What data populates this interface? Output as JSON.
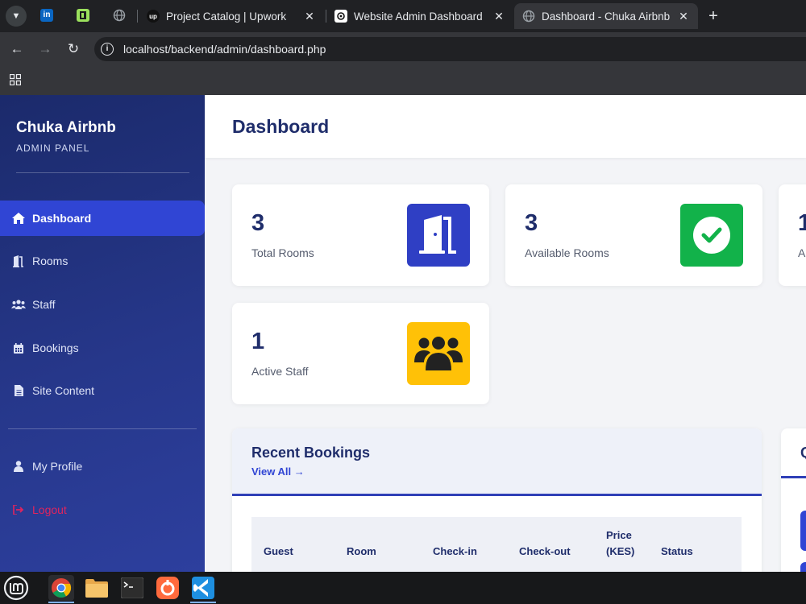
{
  "browser": {
    "tabs": [
      {
        "title": "Project Catalog | Upwork",
        "favicon": "upwork-icon"
      },
      {
        "title": "Website Admin Dashboard S",
        "favicon": "openai-icon"
      },
      {
        "title": "Dashboard - Chuka Airbnb",
        "favicon": "globe-icon",
        "active": true
      }
    ],
    "url": "localhost/backend/admin/dashboard.php",
    "pinned": {
      "linkedin": "in",
      "upwork": "up"
    }
  },
  "sidebar": {
    "brand": "Chuka Airbnb",
    "subtitle": "ADMIN PANEL",
    "items": [
      {
        "label": "Dashboard",
        "icon": "home-icon",
        "active": true
      },
      {
        "label": "Rooms",
        "icon": "door-icon"
      },
      {
        "label": "Staff",
        "icon": "users-icon"
      },
      {
        "label": "Bookings",
        "icon": "calendar-icon"
      },
      {
        "label": "Site Content",
        "icon": "file-icon"
      }
    ],
    "bottom": [
      {
        "label": "My Profile",
        "icon": "user-icon"
      },
      {
        "label": "Logout",
        "icon": "logout-icon"
      }
    ]
  },
  "main": {
    "title": "Dashboard",
    "stats": [
      {
        "value": "3",
        "label": "Total Rooms",
        "color": "#2f3fc4"
      },
      {
        "value": "3",
        "label": "Available Rooms",
        "color": "#12b24a"
      },
      {
        "value": "1",
        "label": "A",
        "color": "#ffffff"
      },
      {
        "value": "1",
        "label": "Active Staff",
        "color": "#ffc107"
      }
    ],
    "recent_bookings": {
      "title": "Recent Bookings",
      "link": "View All →",
      "columns": [
        "Guest",
        "Room",
        "Check-in",
        "Check-out",
        "Price (KES)",
        "Status"
      ]
    },
    "side_panel_title": "Q"
  },
  "colors": {
    "sidebar": "#26378a",
    "accent": "#3045d4",
    "title": "#1f2d6b"
  }
}
